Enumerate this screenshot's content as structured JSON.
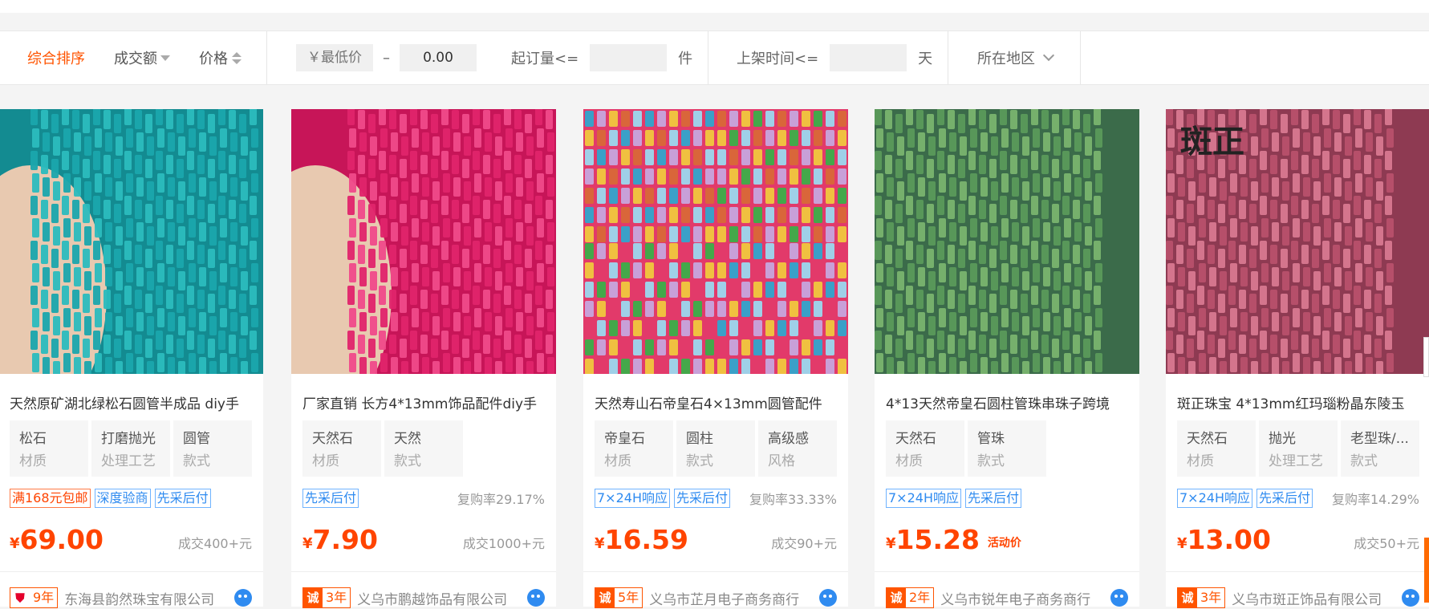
{
  "filters": {
    "sort_default": "综合排序",
    "sort_volume": "成交额",
    "sort_price": "价格",
    "price_min_placeholder": "￥最低价",
    "price_separator": "–",
    "price_max_value": "0.00",
    "moq_label": "起订量<=",
    "moq_unit": "件",
    "listing_time_label": "上架时间<=",
    "listing_time_unit": "天",
    "region_label": "所在地区"
  },
  "colors": {
    "accent": "#ff5400",
    "tag_blue": "#2f8bf0"
  },
  "products": [
    {
      "title": "天然原矿湖北绿松石圆管半成品 diy手",
      "attrs": [
        {
          "value": "松石",
          "key": "材质"
        },
        {
          "value": "打磨抛光",
          "key": "处理工艺"
        },
        {
          "value": "圆管",
          "key": "款式"
        }
      ],
      "tags": [
        {
          "text": "满168元包邮",
          "style": "red"
        },
        {
          "text": "深度验商",
          "style": "blue"
        },
        {
          "text": "先采后付",
          "style": "blue"
        }
      ],
      "repurchase": "",
      "currency": "¥",
      "price": "69.00",
      "promo": "",
      "sold": "成交400+元",
      "badge_icon": "shield-icon",
      "years": "9年",
      "shop": "东海县韵然珠宝有限公司",
      "image_colors": [
        "#1aa7ad",
        "#2bbcbe",
        "#138b91"
      ]
    },
    {
      "title": "厂家直销 长方4*13mm饰品配件diy手",
      "attrs": [
        {
          "value": "天然石",
          "key": "材质"
        },
        {
          "value": "天然",
          "key": "款式"
        }
      ],
      "tags": [
        {
          "text": "先采后付",
          "style": "blue"
        }
      ],
      "repurchase": "复购率29.17%",
      "currency": "¥",
      "price": "7.90",
      "promo": "",
      "sold": "成交1000+元",
      "badge_icon": "cheng-icon",
      "badge_text": "诚",
      "years": "3年",
      "shop": "义乌市鹏越饰品有限公司",
      "image_colors": [
        "#e0246b",
        "#f04a8a",
        "#c71558"
      ]
    },
    {
      "title": "天然寿山石帝皇石4×13mm圆管配件",
      "attrs": [
        {
          "value": "帝皇石",
          "key": "材质"
        },
        {
          "value": "圆柱",
          "key": "款式"
        },
        {
          "value": "高级感",
          "key": "风格"
        }
      ],
      "tags": [
        {
          "text": "7×24H响应",
          "style": "blue"
        },
        {
          "text": "先采后付",
          "style": "blue"
        }
      ],
      "repurchase": "复购率33.33%",
      "currency": "¥",
      "price": "16.59",
      "promo": "",
      "sold": "成交90+元",
      "badge_icon": "cheng-icon",
      "badge_text": "诚",
      "years": "5年",
      "shop": "义乌市芷月电子商务商行",
      "image_colors": [
        "#3aa0c8",
        "#d9663a",
        "#44a84a",
        "#e23a6a"
      ]
    },
    {
      "title": "4*13天然帝皇石圆柱管珠串珠子跨境",
      "attrs": [
        {
          "value": "天然石",
          "key": "材质"
        },
        {
          "value": "管珠",
          "key": "款式"
        }
      ],
      "tags": [
        {
          "text": "7×24H响应",
          "style": "blue"
        },
        {
          "text": "先采后付",
          "style": "blue"
        }
      ],
      "repurchase": "",
      "currency": "¥",
      "price": "15.28",
      "promo": "活动价",
      "sold": "",
      "badge_icon": "cheng-icon",
      "badge_text": "诚",
      "years": "2年",
      "shop": "义乌市锐年电子商务商行",
      "image_colors": [
        "#5a9a5a",
        "#79b46e",
        "#3b6b4a"
      ]
    },
    {
      "title": "斑正珠宝 4*13mm红玛瑙粉晶东陵玉",
      "attrs": [
        {
          "value": "天然石",
          "key": "材质"
        },
        {
          "value": "抛光",
          "key": "处理工艺"
        },
        {
          "value": "老型珠/...",
          "key": "款式"
        }
      ],
      "tags": [
        {
          "text": "7×24H响应",
          "style": "blue"
        },
        {
          "text": "先采后付",
          "style": "blue"
        }
      ],
      "repurchase": "复购率14.29%",
      "currency": "¥",
      "price": "13.00",
      "promo": "",
      "sold": "成交50+元",
      "badge_icon": "cheng-icon",
      "badge_text": "诚",
      "years": "3年",
      "shop": "义乌市斑正饰品有限公司",
      "image_text": "斑正",
      "image_colors": [
        "#b8506b",
        "#d87890",
        "#8e3a52"
      ]
    }
  ]
}
